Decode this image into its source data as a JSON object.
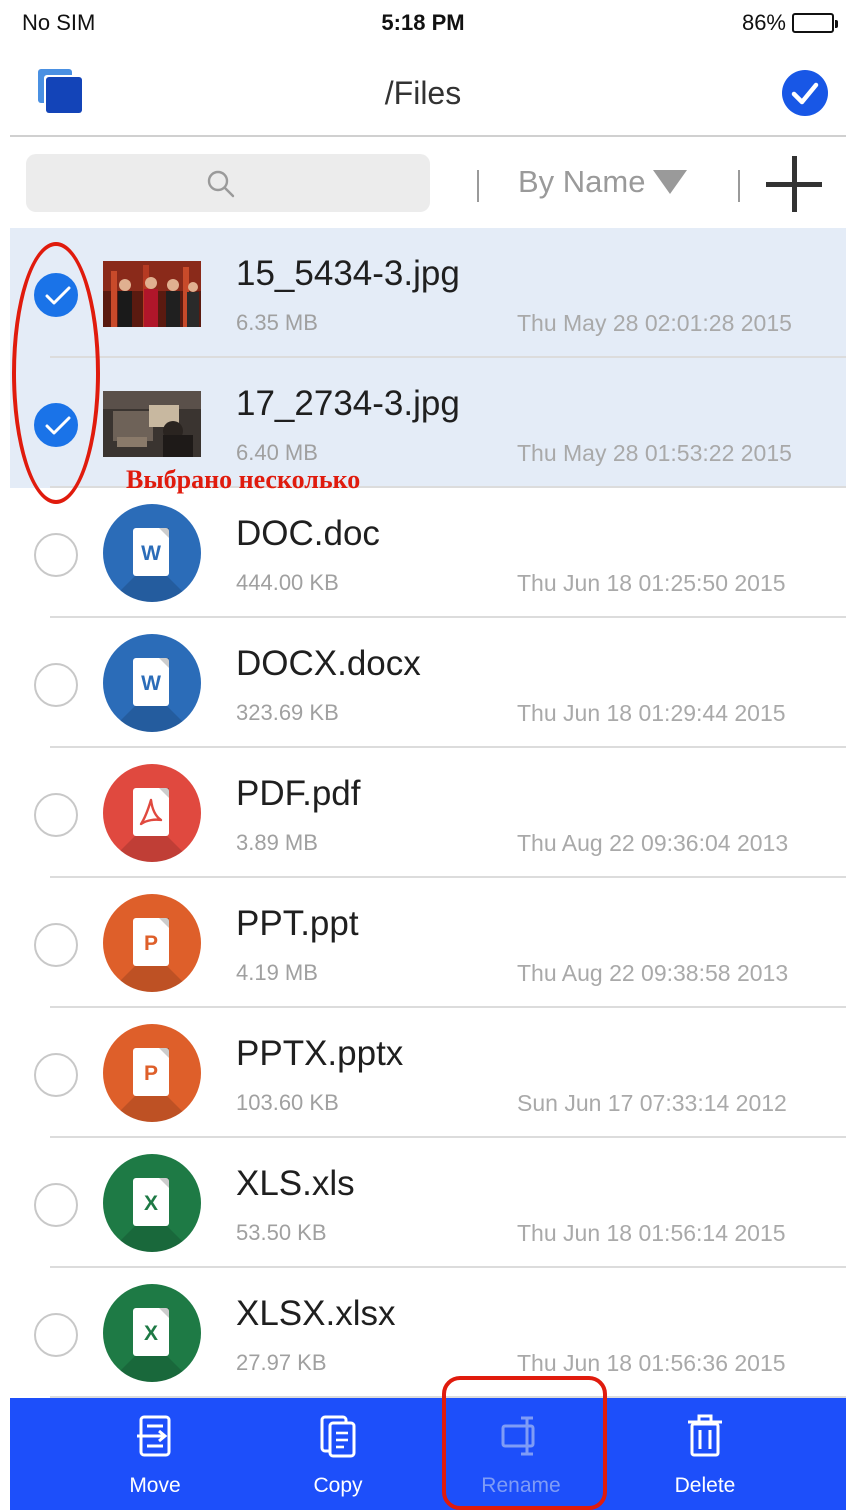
{
  "status_bar": {
    "carrier": "No SIM",
    "time": "5:18 PM",
    "battery": "86%",
    "battery_level": 0.86
  },
  "nav": {
    "title": "/Files",
    "left_icon": "multi-window-icon",
    "right_icon": "select-all-check-icon"
  },
  "toolbar": {
    "search_placeholder": "",
    "sort_label": "By Name",
    "sort_icon": "triangle-down-icon",
    "add_icon": "plus-icon"
  },
  "files": [
    {
      "name": "15_5434-3.jpg",
      "size": "6.35 MB",
      "date": "Thu May 28 02:01:28 2015",
      "type": "image",
      "selected": true
    },
    {
      "name": "17_2734-3.jpg",
      "size": "6.40 MB",
      "date": "Thu May 28 01:53:22 2015",
      "type": "image",
      "selected": true
    },
    {
      "name": "DOC.doc",
      "size": "444.00 KB",
      "date": "Thu Jun 18 01:25:50 2015",
      "type": "word",
      "selected": false
    },
    {
      "name": "DOCX.docx",
      "size": "323.69 KB",
      "date": "Thu Jun 18 01:29:44 2015",
      "type": "word",
      "selected": false
    },
    {
      "name": "PDF.pdf",
      "size": "3.89 MB",
      "date": "Thu Aug 22 09:36:04 2013",
      "type": "pdf",
      "selected": false
    },
    {
      "name": "PPT.ppt",
      "size": "4.19 MB",
      "date": "Thu Aug 22 09:38:58 2013",
      "type": "powerpoint",
      "selected": false
    },
    {
      "name": "PPTX.pptx",
      "size": "103.60 KB",
      "date": "Sun Jun 17 07:33:14 2012",
      "type": "powerpoint",
      "selected": false
    },
    {
      "name": "XLS.xls",
      "size": "53.50 KB",
      "date": "Thu Jun 18 01:56:14 2015",
      "type": "excel",
      "selected": false
    },
    {
      "name": "XLSX.xlsx",
      "size": "27.97 KB",
      "date": "Thu Jun 18 01:56:36 2015",
      "type": "excel",
      "selected": false
    }
  ],
  "annotation": {
    "text": "Выбрано несколько"
  },
  "actions": [
    {
      "label": "Move",
      "icon": "move-icon",
      "enabled": true
    },
    {
      "label": "Copy",
      "icon": "copy-icon",
      "enabled": true
    },
    {
      "label": "Rename",
      "icon": "rename-icon",
      "enabled": false
    },
    {
      "label": "Delete",
      "icon": "trash-icon",
      "enabled": true
    }
  ],
  "colors": {
    "accent": "#1a73e8",
    "action_bar": "#1d4ffa",
    "selected_row": "#e4ecf7",
    "word": "#2b6cb8",
    "pdf": "#e0493f",
    "powerpoint": "#de5f2a",
    "excel": "#1e7a45",
    "annotation": "#e01b0d"
  }
}
